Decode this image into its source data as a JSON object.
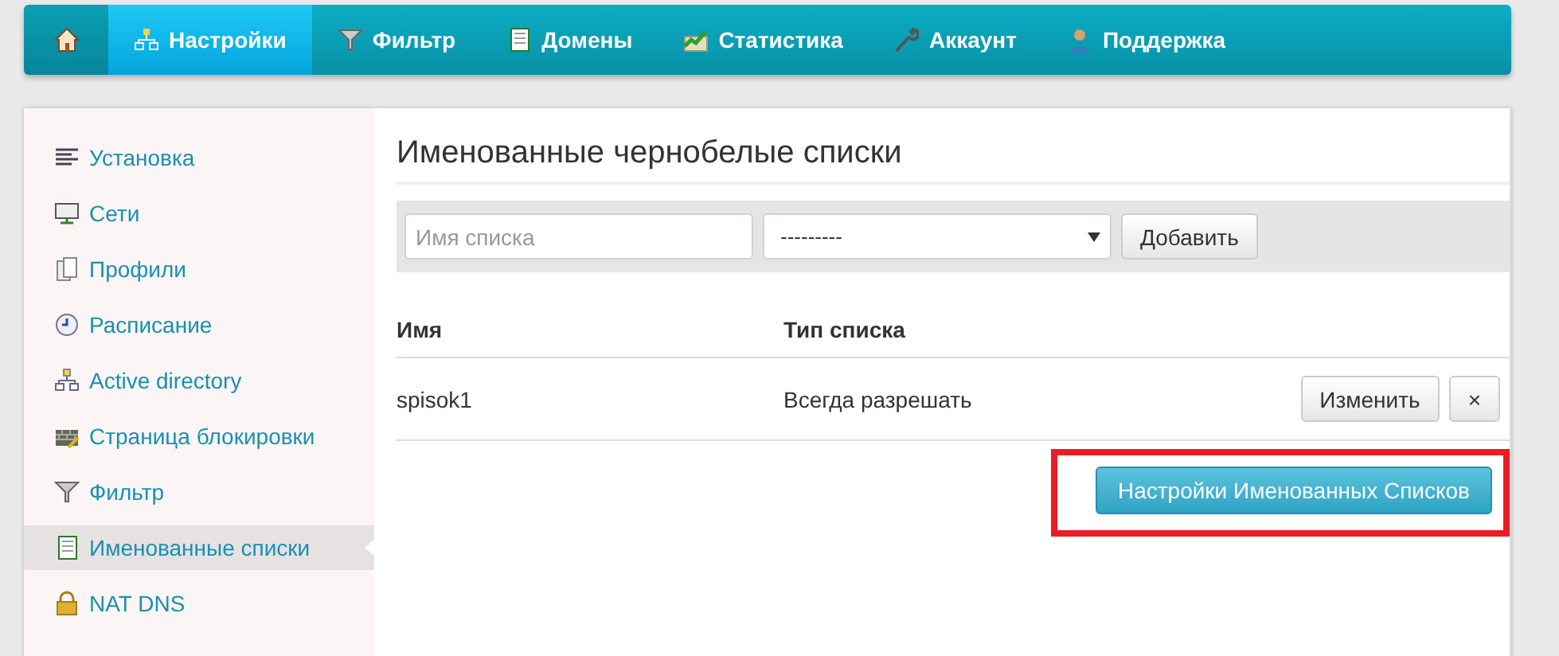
{
  "nav": {
    "home": {
      "selected": false
    },
    "items": [
      {
        "label": "Настройки",
        "selected": true
      },
      {
        "label": "Фильтр",
        "selected": false
      },
      {
        "label": "Домены",
        "selected": false
      },
      {
        "label": "Статистика",
        "selected": false
      },
      {
        "label": "Аккаунт",
        "selected": false
      },
      {
        "label": "Поддержка",
        "selected": false
      }
    ]
  },
  "sidebar": {
    "items": [
      {
        "label": "Установка",
        "selected": false
      },
      {
        "label": "Сети",
        "selected": false
      },
      {
        "label": "Профили",
        "selected": false
      },
      {
        "label": "Расписание",
        "selected": false
      },
      {
        "label": "Active directory",
        "selected": false
      },
      {
        "label": "Страница блокировки",
        "selected": false
      },
      {
        "label": "Фильтр",
        "selected": false
      },
      {
        "label": "Именованные списки",
        "selected": true
      },
      {
        "label": "NAT DNS",
        "selected": false
      }
    ]
  },
  "main": {
    "title": "Именованные чернобелые списки",
    "toolbar": {
      "name_field": {
        "placeholder": "Имя списка"
      },
      "type_select": {
        "value": "---------"
      },
      "add_button": "Добавить"
    },
    "table": {
      "columns": [
        "Имя",
        "Тип списка"
      ],
      "rows": [
        {
          "name": "spisok1",
          "type": "Всегда разрешать",
          "edit_button": "Изменить",
          "delete_button": "×"
        }
      ]
    },
    "settings_button": {
      "label": "Настройки Именованных Списков",
      "highlighted": true
    }
  }
}
